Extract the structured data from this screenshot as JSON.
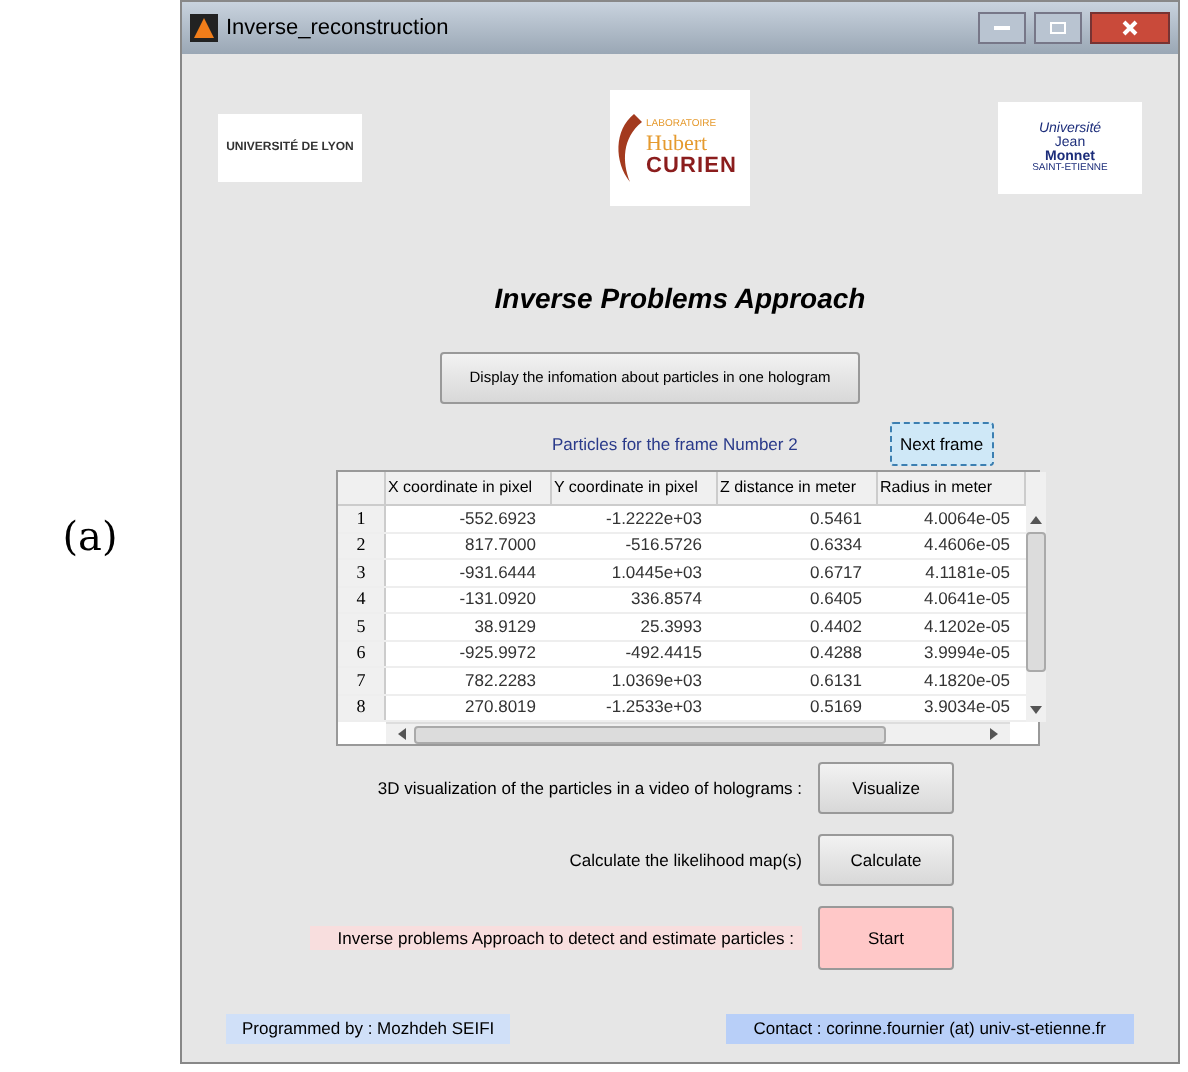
{
  "figure_label": "(a)",
  "window": {
    "title": "Inverse_reconstruction"
  },
  "logos": [
    {
      "kind": "lyon",
      "lines": [
        "UNIVERSITÉ DE LYON"
      ]
    },
    {
      "kind": "curien",
      "lines": [
        "LABORATOIRE",
        "Hubert",
        "CURIEN"
      ]
    },
    {
      "kind": "monnet",
      "lines": [
        "Université",
        "Jean",
        "Monnet",
        "SAINT-ETIENNE"
      ]
    }
  ],
  "heading": "Inverse Problems Approach",
  "display_button": "Display the infomation about particles in one hologram",
  "frame_label": "Particles for the frame Number 2",
  "next_button": "Next frame",
  "table": {
    "columns": [
      "X coordinate in pixel",
      "Y coordinate in pixel",
      "Z distance in meter",
      "Radius in meter"
    ],
    "rows": [
      {
        "index": "1",
        "cells": [
          "-552.6923",
          "-1.2222e+03",
          "0.5461",
          "4.0064e-05"
        ]
      },
      {
        "index": "2",
        "cells": [
          "817.7000",
          "-516.5726",
          "0.6334",
          "4.4606e-05"
        ]
      },
      {
        "index": "3",
        "cells": [
          "-931.6444",
          "1.0445e+03",
          "0.6717",
          "4.1181e-05"
        ]
      },
      {
        "index": "4",
        "cells": [
          "-131.0920",
          "336.8574",
          "0.6405",
          "4.0641e-05"
        ]
      },
      {
        "index": "5",
        "cells": [
          "38.9129",
          "25.3993",
          "0.4402",
          "4.1202e-05"
        ]
      },
      {
        "index": "6",
        "cells": [
          "-925.9972",
          "-492.4415",
          "0.4288",
          "3.9994e-05"
        ]
      },
      {
        "index": "7",
        "cells": [
          "782.2283",
          "1.0369e+03",
          "0.6131",
          "4.1820e-05"
        ]
      },
      {
        "index": "8",
        "cells": [
          "270.8019",
          "-1.2533e+03",
          "0.5169",
          "3.9034e-05"
        ]
      }
    ]
  },
  "actions": [
    {
      "label": "3D visualization of the particles in a video of holograms :",
      "button": "Visualize",
      "highlight": false
    },
    {
      "label": "Calculate the likelihood map(s)",
      "button": "Calculate",
      "highlight": false
    },
    {
      "label": "Inverse problems Approach to detect and estimate particles :",
      "button": "Start",
      "highlight": true
    }
  ],
  "footer": {
    "author": "Programmed by : Mozhdeh SEIFI",
    "contact": "Contact : corinne.fournier (at) univ-st-etienne.fr"
  }
}
